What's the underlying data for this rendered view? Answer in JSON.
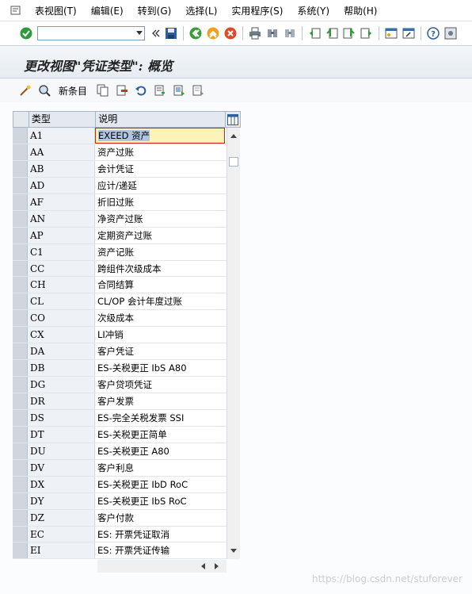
{
  "menubar": {
    "items": [
      "表视图(T)",
      "编辑(E)",
      "转到(G)",
      "选择(L)",
      "实用程序(S)",
      "系统(Y)",
      "帮助(H)"
    ]
  },
  "toolbar": {
    "command_value": "",
    "icons": [
      "enter-icon",
      "save-icon",
      "back-icon",
      "exit-icon",
      "cancel-icon",
      "print-icon",
      "find-icon",
      "find-next-icon",
      "first-page-icon",
      "prev-page-icon",
      "next-page-icon",
      "last-page-icon",
      "new-session-icon",
      "shortcut-icon",
      "help-icon"
    ]
  },
  "title": "更改视图\"凭证类型\": 概览",
  "app_toolbar": {
    "new_entries_label": "新条目",
    "icons": [
      "change-display-icon",
      "details-icon",
      "copy-icon",
      "delete-icon",
      "undo-icon",
      "select-all-icon",
      "select-block-icon",
      "deselect-all-icon"
    ]
  },
  "table": {
    "columns": [
      "类型",
      "说明"
    ],
    "rows": [
      {
        "type": "A1",
        "desc": "EXEED 资产"
      },
      {
        "type": "AA",
        "desc": "资产过账"
      },
      {
        "type": "AB",
        "desc": "会计凭证"
      },
      {
        "type": "AD",
        "desc": "应计/递延"
      },
      {
        "type": "AF",
        "desc": "折旧过账"
      },
      {
        "type": "AN",
        "desc": "净资产过账"
      },
      {
        "type": "AP",
        "desc": "定期资产过账"
      },
      {
        "type": "C1",
        "desc": "资产记账"
      },
      {
        "type": "CC",
        "desc": "跨组件次级成本"
      },
      {
        "type": "CH",
        "desc": "合同结算"
      },
      {
        "type": "CL",
        "desc": "CL/OP 会计年度过账"
      },
      {
        "type": "CO",
        "desc": "次级成本"
      },
      {
        "type": "CX",
        "desc": "LI冲销"
      },
      {
        "type": "DA",
        "desc": "客户凭证"
      },
      {
        "type": "DB",
        "desc": "ES-关税更正 IbS A80"
      },
      {
        "type": "DG",
        "desc": "客户贷项凭证"
      },
      {
        "type": "DR",
        "desc": "客户发票"
      },
      {
        "type": "DS",
        "desc": "ES-完全关税发票 SSI"
      },
      {
        "type": "DT",
        "desc": "ES-关税更正简单"
      },
      {
        "type": "DU",
        "desc": "ES-关税更正 A80"
      },
      {
        "type": "DV",
        "desc": "客户利息"
      },
      {
        "type": "DX",
        "desc": "ES-关税更正 IbD RoC"
      },
      {
        "type": "DY",
        "desc": "ES-关税更正 IbS RoC"
      },
      {
        "type": "DZ",
        "desc": "客户付款"
      },
      {
        "type": "EC",
        "desc": "ES: 开票凭证取消"
      },
      {
        "type": "EI",
        "desc": "ES: 开票凭证传输"
      }
    ]
  },
  "watermark": "https://blog.csdn.net/stuforever",
  "colors": {
    "accent_green": "#2e9a3a",
    "header_bg": "#e4e9ef",
    "selected_cell": "#fdf3b8",
    "focus_border": "#cc2222"
  }
}
